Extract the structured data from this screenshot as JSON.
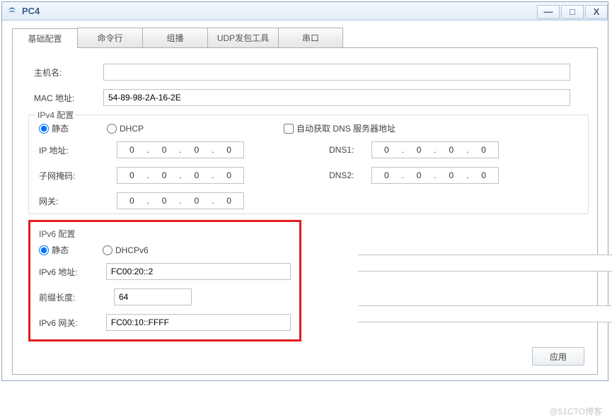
{
  "window": {
    "title": "PC4",
    "controls": {
      "min": "—",
      "max": "□",
      "close": "X"
    }
  },
  "tabs": [
    {
      "label": "基础配置",
      "active": true
    },
    {
      "label": "命令行"
    },
    {
      "label": "组播"
    },
    {
      "label": "UDP发包工具"
    },
    {
      "label": "串口"
    }
  ],
  "basic": {
    "hostname_label": "主机名:",
    "hostname_value": "",
    "mac_label": "MAC 地址:",
    "mac_value": "54-89-98-2A-16-2E"
  },
  "ipv4": {
    "legend": "IPv4 配置",
    "static_label": "静态",
    "dhcp_label": "DHCP",
    "auto_dns_label": "自动获取 DNS 服务器地址",
    "ip_label": "IP 地址:",
    "mask_label": "子网掩码:",
    "gw_label": "网关:",
    "dns1_label": "DNS1:",
    "dns2_label": "DNS2:",
    "octets": {
      "a": "0",
      "b": "0",
      "c": "0",
      "d": "0"
    }
  },
  "ipv6": {
    "legend": "IPv6 配置",
    "static_label": "静态",
    "dhcpv6_label": "DHCPv6",
    "addr_label": "IPv6 地址:",
    "addr_value": "FC00:20::2",
    "prefix_label": "前缀长度:",
    "prefix_value": "64",
    "gw_label": "IPv6 网关:",
    "gw_value": "FC00:10::FFFF"
  },
  "buttons": {
    "apply": "应用"
  },
  "watermark": "@51CTO博客"
}
